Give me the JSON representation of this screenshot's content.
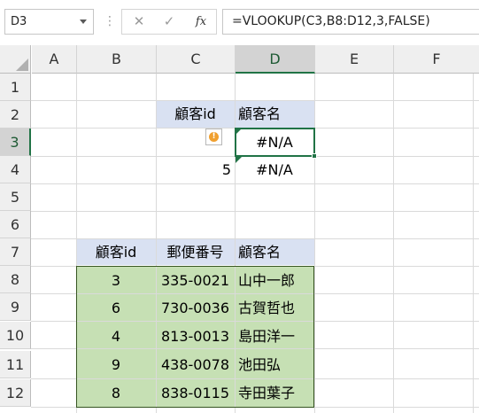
{
  "formula_bar": {
    "name_box": "D3",
    "dots": "⋮",
    "cancel_icon": "✕",
    "enter_icon": "✓",
    "fx_label": "fx",
    "formula": "=VLOOKUP(C3,B8:D12,3,FALSE)"
  },
  "columns": [
    "A",
    "B",
    "C",
    "D",
    "E",
    "F"
  ],
  "rows": [
    "1",
    "2",
    "3",
    "4",
    "5",
    "6",
    "7",
    "8",
    "9",
    "10",
    "11",
    "12"
  ],
  "lookup": {
    "header_id": "顧客id",
    "header_name": "顧客名",
    "c3": "",
    "d3": "#N/A",
    "c4": "5",
    "d4": "#N/A"
  },
  "table": {
    "headers": [
      "顧客id",
      "郵便番号",
      "顧客名"
    ],
    "rows": [
      [
        "3",
        "335-0021",
        "山中一郎"
      ],
      [
        "6",
        "730-0036",
        "古賀哲也"
      ],
      [
        "4",
        "813-0013",
        "島田洋一"
      ],
      [
        "9",
        "438-0078",
        "池田弘"
      ],
      [
        "8",
        "838-0115",
        "寺田葉子"
      ]
    ]
  },
  "warning_icon": "!",
  "colors": {
    "accent": "#217346",
    "header_fill": "#d9e1f2",
    "table_fill": "#c6e0b4"
  }
}
